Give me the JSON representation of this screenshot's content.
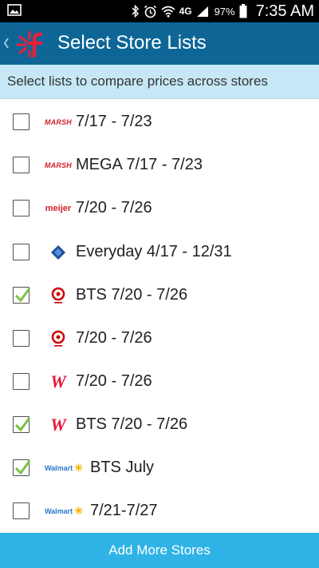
{
  "status_bar": {
    "network": "4G",
    "battery": "97%",
    "time": "7:35 AM"
  },
  "header": {
    "title": "Select Store Lists"
  },
  "subheader": {
    "text": "Select lists to compare prices across stores"
  },
  "lists": [
    {
      "store": "marsh",
      "logo_text": "MARSH",
      "label": "7/17 - 7/23",
      "checked": false
    },
    {
      "store": "marsh",
      "logo_text": "MARSH",
      "label": "MEGA 7/17 - 7/23",
      "checked": false
    },
    {
      "store": "meijer",
      "logo_text": "meijer",
      "label": "7/20 - 7/26",
      "checked": false
    },
    {
      "store": "sams-club",
      "logo_text": "",
      "label": "Everyday 4/17 - 12/31",
      "checked": false
    },
    {
      "store": "target",
      "logo_text": "",
      "label": "BTS 7/20 - 7/26",
      "checked": true
    },
    {
      "store": "target",
      "logo_text": "",
      "label": "7/20 - 7/26",
      "checked": false
    },
    {
      "store": "walgreens",
      "logo_text": "W",
      "label": "7/20 - 7/26",
      "checked": false
    },
    {
      "store": "walgreens",
      "logo_text": "W",
      "label": "BTS 7/20 - 7/26",
      "checked": true
    },
    {
      "store": "walmart",
      "logo_text": "Walmart",
      "label": "BTS July",
      "checked": true
    },
    {
      "store": "walmart",
      "logo_text": "Walmart",
      "label": "7/21-7/27",
      "checked": false
    }
  ],
  "footer": {
    "button_label": "Add More Stores"
  },
  "colors": {
    "app_bar": "#0e6697",
    "subheader": "#c6e8f6",
    "footer": "#2fb3e6",
    "check": "#7bc142"
  }
}
